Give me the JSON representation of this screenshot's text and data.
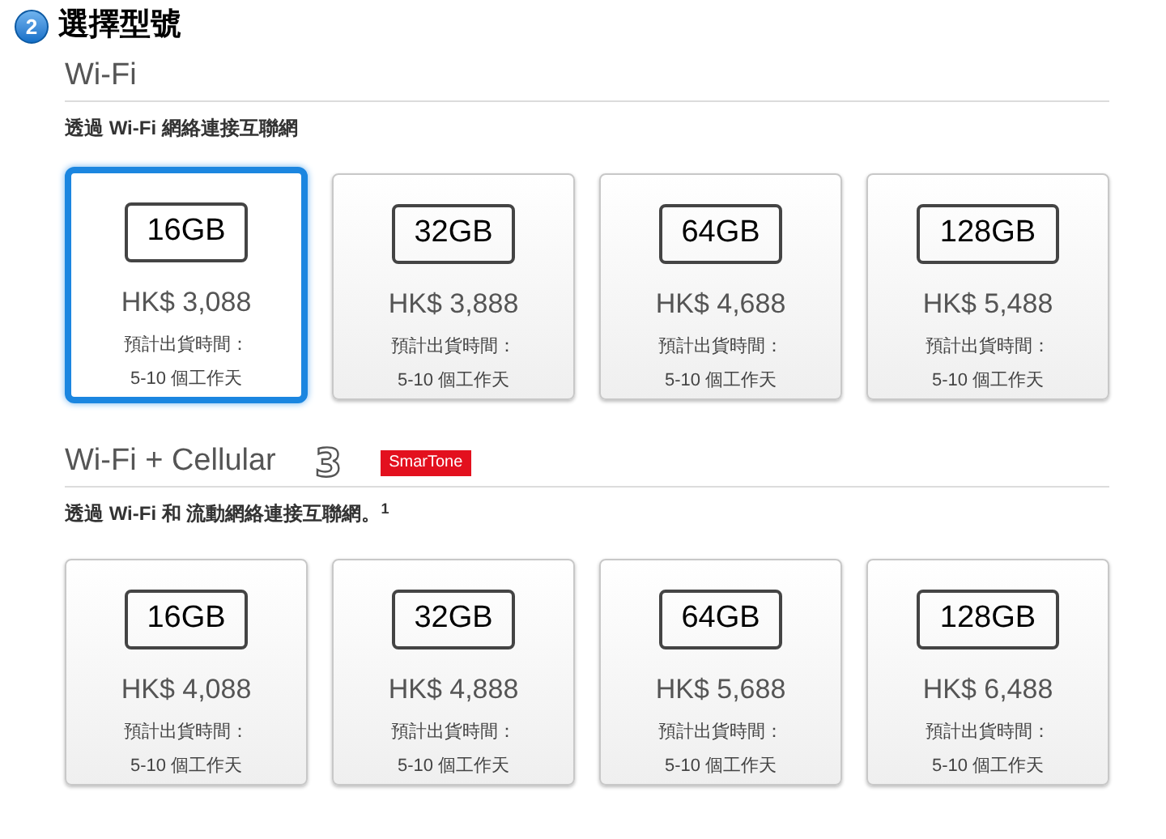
{
  "step": {
    "number": "2",
    "title": "選擇型號"
  },
  "sections": [
    {
      "title": "Wi-Fi",
      "description": "透過 Wi-Fi 網絡連接互聯網",
      "models": [
        {
          "capacity": "16GB",
          "price": "HK$ 3,088",
          "shipping_label": "預計出貨時間：",
          "shipping_time": "5-10 個工作天",
          "selected": true
        },
        {
          "capacity": "32GB",
          "price": "HK$ 3,888",
          "shipping_label": "預計出貨時間：",
          "shipping_time": "5-10 個工作天",
          "selected": false
        },
        {
          "capacity": "64GB",
          "price": "HK$ 4,688",
          "shipping_label": "預計出貨時間：",
          "shipping_time": "5-10 個工作天",
          "selected": false
        },
        {
          "capacity": "128GB",
          "price": "HK$ 5,488",
          "shipping_label": "預計出貨時間：",
          "shipping_time": "5-10 個工作天",
          "selected": false
        }
      ]
    },
    {
      "title": "Wi-Fi + Cellular",
      "carriers": [
        {
          "kind": "outline",
          "label": "3"
        },
        {
          "kind": "badge",
          "label": "SmarTone"
        }
      ],
      "description": "透過 Wi-Fi 和 流動網絡連接互聯網。$^{1}$",
      "models": [
        {
          "capacity": "16GB",
          "price": "HK$ 4,088",
          "shipping_label": "預計出貨時間：",
          "shipping_time": "5-10 個工作天",
          "selected": false
        },
        {
          "capacity": "32GB",
          "price": "HK$ 4,888",
          "shipping_label": "預計出貨時間：",
          "shipping_time": "5-10 個工作天",
          "selected": false
        },
        {
          "capacity": "64GB",
          "price": "HK$ 5,688",
          "shipping_label": "預計出貨時間：",
          "shipping_time": "5-10 個工作天",
          "selected": false
        },
        {
          "capacity": "128GB",
          "price": "HK$ 6,488",
          "shipping_label": "預計出貨時間：",
          "shipping_time": "5-10 個工作天",
          "selected": false
        }
      ]
    }
  ]
}
